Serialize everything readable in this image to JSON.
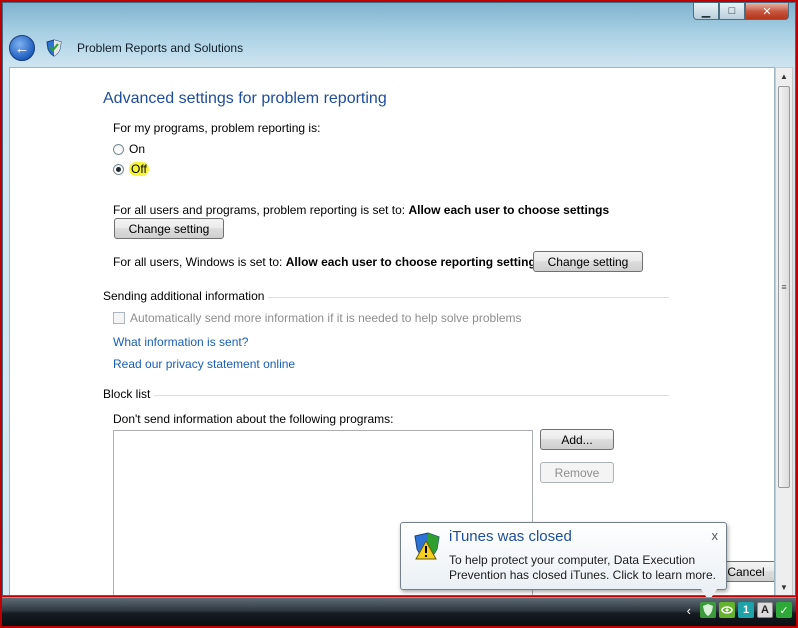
{
  "window": {
    "title": "Problem Reports and Solutions",
    "caption_buttons": {
      "minimize": "▁",
      "maximize": "□",
      "close": "✕"
    }
  },
  "nav": {
    "back_icon": "back-arrow-icon",
    "app_icon": "shield-icon"
  },
  "page": {
    "title": "Advanced settings for problem reporting",
    "my_programs_label": "For my programs, problem reporting is:",
    "radio_on": "On",
    "radio_off": "Off",
    "selected": "Off",
    "all_users_programs_text": "For all users and programs, problem reporting is set to:",
    "all_users_programs_value": "Allow each user to choose settings",
    "change_setting_1": "Change setting",
    "all_users_windows_text": "For all users, Windows is set to:",
    "all_users_windows_value": "Allow each user to choose reporting settings",
    "change_setting_2": "Change setting",
    "sending_group": "Sending additional information",
    "auto_send_checkbox": "Automatically send more information if it is needed to help solve problems",
    "auto_send_checked": false,
    "what_info_link": "What information is sent?",
    "privacy_link": "Read our privacy statement online",
    "block_group": "Block list",
    "block_label": "Don't send information about the following programs:",
    "block_items": [],
    "add_button": "Add...",
    "remove_button": "Remove",
    "cancel_button": "Cancel"
  },
  "notification": {
    "title": "iTunes was closed",
    "body": "To help protect your computer, Data Execution Prevention has closed iTunes.  Click to learn more.",
    "close": "x",
    "icon": "shield-warning-icon"
  },
  "taskbar": {
    "tray_chevron": "‹",
    "tray_icons": [
      {
        "name": "action-center-shield-icon",
        "glyph": "",
        "color": "#3c9a3c"
      },
      {
        "name": "nvidia-icon",
        "glyph": "",
        "color": "#64b32e"
      },
      {
        "name": "tray-app-1-icon",
        "glyph": "1",
        "color": "#1da3a8"
      },
      {
        "name": "tray-app-a-icon",
        "glyph": "A",
        "color": "#dcdcdc"
      },
      {
        "name": "tray-check-icon",
        "glyph": "✓",
        "color": "#2fa83a"
      }
    ]
  },
  "colors": {
    "accent_blue": "#1e4d9b",
    "link": "#1a5fb4",
    "highlight": "#f7f53a",
    "border_red": "#c00000"
  }
}
